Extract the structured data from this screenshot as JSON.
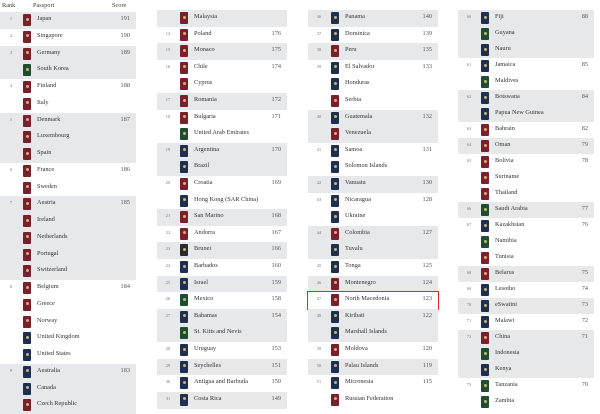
{
  "header": {
    "rank_label": "Rank",
    "passport_label": "Passport",
    "score_label": "Score"
  },
  "highlight": {
    "name": "North Macedonia"
  },
  "colors": {
    "shade": "#e6e8ea",
    "highlight": "#e0282a",
    "burgundy": "#7a1f2e",
    "navy": "#1f2f52",
    "green": "#1f4d33",
    "black": "#2a2a2a"
  },
  "columns": [
    {
      "rows": [
        {
          "rank": "1",
          "name": "Japan",
          "score": "191",
          "shade": true,
          "c": "burgundy"
        },
        {
          "rank": "2",
          "name": "Singapore",
          "score": "190",
          "shade": false,
          "c": "burgundy"
        },
        {
          "rank": "3",
          "name": "Germany",
          "score": "189",
          "shade": true,
          "c": "burgundy"
        },
        {
          "rank": "",
          "name": "South Korea",
          "score": "",
          "shade": true,
          "c": "green"
        },
        {
          "rank": "4",
          "name": "Finland",
          "score": "188",
          "shade": false,
          "c": "burgundy"
        },
        {
          "rank": "",
          "name": "Italy",
          "score": "",
          "shade": false,
          "c": "burgundy"
        },
        {
          "rank": "5",
          "name": "Denmark",
          "score": "187",
          "shade": true,
          "c": "burgundy"
        },
        {
          "rank": "",
          "name": "Luxembourg",
          "score": "",
          "shade": true,
          "c": "burgundy"
        },
        {
          "rank": "",
          "name": "Spain",
          "score": "",
          "shade": true,
          "c": "burgundy"
        },
        {
          "rank": "6",
          "name": "France",
          "score": "186",
          "shade": false,
          "c": "burgundy"
        },
        {
          "rank": "",
          "name": "Sweden",
          "score": "",
          "shade": false,
          "c": "burgundy"
        },
        {
          "rank": "7",
          "name": "Austria",
          "score": "185",
          "shade": true,
          "c": "burgundy"
        },
        {
          "rank": "",
          "name": "Ireland",
          "score": "",
          "shade": true,
          "c": "burgundy"
        },
        {
          "rank": "",
          "name": "Netherlands",
          "score": "",
          "shade": true,
          "c": "burgundy"
        },
        {
          "rank": "",
          "name": "Portugal",
          "score": "",
          "shade": true,
          "c": "burgundy"
        },
        {
          "rank": "",
          "name": "Switzerland",
          "score": "",
          "shade": true,
          "c": "burgundy"
        },
        {
          "rank": "8",
          "name": "Belgium",
          "score": "184",
          "shade": false,
          "c": "burgundy"
        },
        {
          "rank": "",
          "name": "Greece",
          "score": "",
          "shade": false,
          "c": "burgundy"
        },
        {
          "rank": "",
          "name": "Norway",
          "score": "",
          "shade": false,
          "c": "burgundy"
        },
        {
          "rank": "",
          "name": "United Kingdom",
          "score": "",
          "shade": false,
          "c": "navy"
        },
        {
          "rank": "",
          "name": "United States",
          "score": "",
          "shade": false,
          "c": "navy"
        },
        {
          "rank": "9",
          "name": "Australia",
          "score": "183",
          "shade": true,
          "c": "navy"
        },
        {
          "rank": "",
          "name": "Canada",
          "score": "",
          "shade": true,
          "c": "navy"
        },
        {
          "rank": "",
          "name": "Czech Republic",
          "score": "",
          "shade": true,
          "c": "burgundy"
        }
      ]
    },
    {
      "rows": [
        {
          "rank": "",
          "name": "Malaysia",
          "score": "",
          "shade": true,
          "c": "burgundy"
        },
        {
          "rank": "14",
          "name": "Poland",
          "score": "176",
          "shade": false,
          "c": "burgundy"
        },
        {
          "rank": "15",
          "name": "Monaco",
          "score": "175",
          "shade": true,
          "c": "burgundy"
        },
        {
          "rank": "16",
          "name": "Chile",
          "score": "174",
          "shade": false,
          "c": "burgundy"
        },
        {
          "rank": "",
          "name": "Cyprus",
          "score": "",
          "shade": false,
          "c": "burgundy"
        },
        {
          "rank": "17",
          "name": "Romania",
          "score": "172",
          "shade": true,
          "c": "burgundy"
        },
        {
          "rank": "18",
          "name": "Bulgaria",
          "score": "171",
          "shade": false,
          "c": "burgundy"
        },
        {
          "rank": "",
          "name": "United Arab Emirates",
          "score": "",
          "shade": false,
          "c": "green"
        },
        {
          "rank": "19",
          "name": "Argentina",
          "score": "170",
          "shade": true,
          "c": "navy"
        },
        {
          "rank": "",
          "name": "Brazil",
          "score": "",
          "shade": true,
          "c": "navy"
        },
        {
          "rank": "20",
          "name": "Croatia",
          "score": "169",
          "shade": false,
          "c": "burgundy"
        },
        {
          "rank": "",
          "name": "Hong Kong (SAR China)",
          "score": "",
          "shade": false,
          "c": "navy"
        },
        {
          "rank": "21",
          "name": "San Marino",
          "score": "168",
          "shade": true,
          "c": "burgundy"
        },
        {
          "rank": "22",
          "name": "Andorra",
          "score": "167",
          "shade": false,
          "c": "burgundy"
        },
        {
          "rank": "23",
          "name": "Brunei",
          "score": "166",
          "shade": true,
          "c": "black"
        },
        {
          "rank": "24",
          "name": "Barbados",
          "score": "160",
          "shade": false,
          "c": "navy"
        },
        {
          "rank": "25",
          "name": "Israel",
          "score": "159",
          "shade": true,
          "c": "navy"
        },
        {
          "rank": "26",
          "name": "Mexico",
          "score": "158",
          "shade": false,
          "c": "green"
        },
        {
          "rank": "27",
          "name": "Bahamas",
          "score": "154",
          "shade": true,
          "c": "navy"
        },
        {
          "rank": "",
          "name": "St. Kitts and Nevis",
          "score": "",
          "shade": true,
          "c": "green"
        },
        {
          "rank": "28",
          "name": "Uruguay",
          "score": "153",
          "shade": false,
          "c": "navy"
        },
        {
          "rank": "29",
          "name": "Seychelles",
          "score": "151",
          "shade": true,
          "c": "navy"
        },
        {
          "rank": "30",
          "name": "Antigua and Barbuda",
          "score": "150",
          "shade": false,
          "c": "navy"
        },
        {
          "rank": "31",
          "name": "Costa Rica",
          "score": "149",
          "shade": true,
          "c": "navy"
        }
      ]
    },
    {
      "rows": [
        {
          "rank": "36",
          "name": "Panama",
          "score": "140",
          "shade": true,
          "c": "navy"
        },
        {
          "rank": "37",
          "name": "Dominica",
          "score": "139",
          "shade": false,
          "c": "navy"
        },
        {
          "rank": "38",
          "name": "Peru",
          "score": "135",
          "shade": true,
          "c": "burgundy"
        },
        {
          "rank": "39",
          "name": "El Salvador",
          "score": "133",
          "shade": false,
          "c": "navy"
        },
        {
          "rank": "",
          "name": "Honduras",
          "score": "",
          "shade": false,
          "c": "navy"
        },
        {
          "rank": "",
          "name": "Serbia",
          "score": "",
          "shade": false,
          "c": "burgundy"
        },
        {
          "rank": "40",
          "name": "Guatemala",
          "score": "132",
          "shade": true,
          "c": "navy"
        },
        {
          "rank": "",
          "name": "Venezuela",
          "score": "",
          "shade": true,
          "c": "burgundy"
        },
        {
          "rank": "41",
          "name": "Samoa",
          "score": "131",
          "shade": false,
          "c": "navy"
        },
        {
          "rank": "",
          "name": "Solomon Islands",
          "score": "",
          "shade": false,
          "c": "navy"
        },
        {
          "rank": "42",
          "name": "Vanuatu",
          "score": "130",
          "shade": true,
          "c": "navy"
        },
        {
          "rank": "43",
          "name": "Nicaragua",
          "score": "128",
          "shade": false,
          "c": "navy"
        },
        {
          "rank": "",
          "name": "Ukraine",
          "score": "",
          "shade": false,
          "c": "navy"
        },
        {
          "rank": "44",
          "name": "Colombia",
          "score": "127",
          "shade": true,
          "c": "burgundy"
        },
        {
          "rank": "",
          "name": "Tuvalu",
          "score": "",
          "shade": true,
          "c": "navy"
        },
        {
          "rank": "45",
          "name": "Tonga",
          "score": "125",
          "shade": false,
          "c": "navy"
        },
        {
          "rank": "46",
          "name": "Montenegro",
          "score": "124",
          "shade": true,
          "c": "burgundy"
        },
        {
          "rank": "47",
          "name": "North Macedonia",
          "score": "123",
          "shade": false,
          "c": "burgundy"
        },
        {
          "rank": "48",
          "name": "Kiribati",
          "score": "122",
          "shade": true,
          "c": "navy"
        },
        {
          "rank": "",
          "name": "Marshall Islands",
          "score": "",
          "shade": true,
          "c": "navy"
        },
        {
          "rank": "49",
          "name": "Moldova",
          "score": "120",
          "shade": false,
          "c": "burgundy"
        },
        {
          "rank": "50",
          "name": "Palau Islands",
          "score": "119",
          "shade": true,
          "c": "navy"
        },
        {
          "rank": "51",
          "name": "Micronesia",
          "score": "115",
          "shade": false,
          "c": "navy"
        },
        {
          "rank": "",
          "name": "Russian Federation",
          "score": "",
          "shade": false,
          "c": "burgundy"
        }
      ]
    },
    {
      "rows": [
        {
          "rank": "60",
          "name": "Fiji",
          "score": "88",
          "shade": true,
          "c": "navy"
        },
        {
          "rank": "",
          "name": "Guyana",
          "score": "",
          "shade": true,
          "c": "green"
        },
        {
          "rank": "",
          "name": "Nauru",
          "score": "",
          "shade": true,
          "c": "navy"
        },
        {
          "rank": "61",
          "name": "Jamaica",
          "score": "85",
          "shade": false,
          "c": "navy"
        },
        {
          "rank": "",
          "name": "Maldives",
          "score": "",
          "shade": false,
          "c": "green"
        },
        {
          "rank": "62",
          "name": "Botswana",
          "score": "84",
          "shade": true,
          "c": "navy"
        },
        {
          "rank": "",
          "name": "Papua New Guinea",
          "score": "",
          "shade": true,
          "c": "navy"
        },
        {
          "rank": "63",
          "name": "Bahrain",
          "score": "82",
          "shade": false,
          "c": "burgundy"
        },
        {
          "rank": "64",
          "name": "Oman",
          "score": "79",
          "shade": true,
          "c": "burgundy"
        },
        {
          "rank": "65",
          "name": "Bolivia",
          "score": "78",
          "shade": false,
          "c": "burgundy"
        },
        {
          "rank": "",
          "name": "Suriname",
          "score": "",
          "shade": false,
          "c": "burgundy"
        },
        {
          "rank": "",
          "name": "Thailand",
          "score": "",
          "shade": false,
          "c": "burgundy"
        },
        {
          "rank": "66",
          "name": "Saudi Arabia",
          "score": "77",
          "shade": true,
          "c": "green"
        },
        {
          "rank": "67",
          "name": "Kazakhstan",
          "score": "76",
          "shade": false,
          "c": "navy"
        },
        {
          "rank": "",
          "name": "Namibia",
          "score": "",
          "shade": false,
          "c": "green"
        },
        {
          "rank": "",
          "name": "Tunisia",
          "score": "",
          "shade": false,
          "c": "burgundy"
        },
        {
          "rank": "68",
          "name": "Belarus",
          "score": "75",
          "shade": true,
          "c": "burgundy"
        },
        {
          "rank": "69",
          "name": "Lesotho",
          "score": "74",
          "shade": false,
          "c": "navy"
        },
        {
          "rank": "70",
          "name": "eSwatini",
          "score": "73",
          "shade": true,
          "c": "navy"
        },
        {
          "rank": "71",
          "name": "Malawi",
          "score": "72",
          "shade": false,
          "c": "navy"
        },
        {
          "rank": "72",
          "name": "China",
          "score": "71",
          "shade": true,
          "c": "burgundy"
        },
        {
          "rank": "",
          "name": "Indonesia",
          "score": "",
          "shade": true,
          "c": "green"
        },
        {
          "rank": "",
          "name": "Kenya",
          "score": "",
          "shade": true,
          "c": "navy"
        },
        {
          "rank": "73",
          "name": "Tanzania",
          "score": "70",
          "shade": false,
          "c": "green"
        },
        {
          "rank": "",
          "name": "Zambia",
          "score": "",
          "shade": false,
          "c": "green"
        }
      ]
    }
  ]
}
